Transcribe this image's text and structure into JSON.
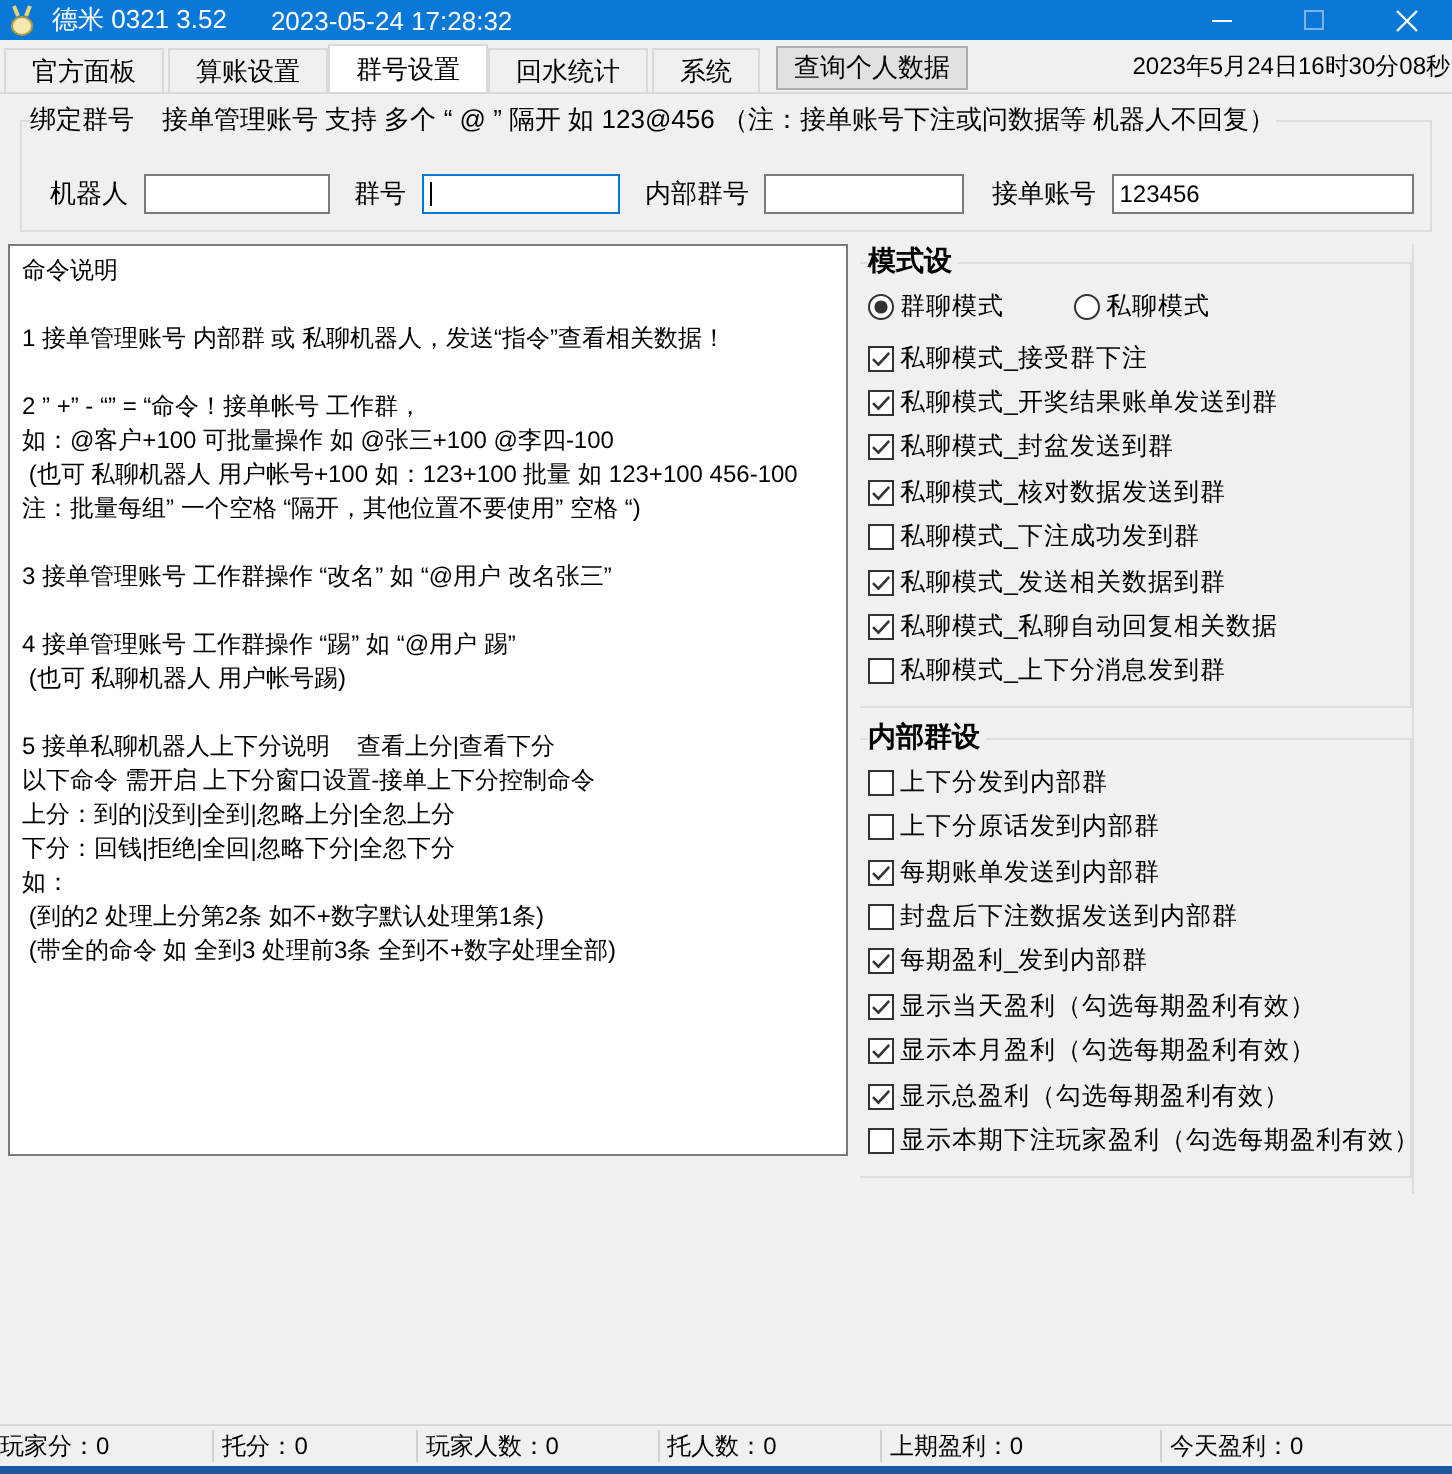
{
  "window": {
    "title": "德米 0321 3.52",
    "time": "2023-05-24 17:28:32"
  },
  "tabs": [
    {
      "label": "官方面板",
      "selected": false
    },
    {
      "label": "算账设置",
      "selected": false
    },
    {
      "label": "群号设置",
      "selected": true
    },
    {
      "label": "回水统计",
      "selected": false
    },
    {
      "label": "系统",
      "selected": false
    }
  ],
  "query_button": "查询个人数据",
  "clock": "2023年5月24日16时30分08秒",
  "bind_group": {
    "title": "绑定群号",
    "note": "接单管理账号 支持 多个 “ @ ” 隔开 如 123@456 （注：接单账号下注或问数据等 机器人不回复）",
    "fields": [
      {
        "label": "机器人",
        "focused": false
      },
      {
        "label": "群号",
        "focused": true
      },
      {
        "label": "内部群号",
        "focused": false
      },
      {
        "label": "接单账号",
        "value": "123456",
        "focused": false
      }
    ]
  },
  "instructions": {
    "paragraphs": [
      [
        "命令说明"
      ],
      [
        "1 接单管理账号 内部群 或 私聊机器人，发送“指令”查看相关数据！"
      ],
      [
        "2 ” +” - “” = “命令！接单帐号 工作群，",
        "如：@客户+100 可批量操作 如 @张三+100 @李四-100",
        " (也可 私聊机器人 用户帐号+100 如：123+100 批量 如 123+100 456-100",
        "注：批量每组” 一个空格 “隔开，其他位置不要使用” 空格 “)"
      ],
      [
        "3 接单管理账号 工作群操作 “改名” 如 “@用户 改名张三”"
      ],
      [
        "4 接单管理账号 工作群操作 “踢” 如 “@用户 踢”",
        " (也可 私聊机器人 用户帐号踢)"
      ],
      [
        "5 接单私聊机器人上下分说明    查看上分|查看下分",
        "以下命令 需开启 上下分窗口设置-接单上下分控制命令",
        "上分：到的|没到|全到|忽略上分|全忽上分",
        "下分：回钱|拒绝|全回|忽略下分|全忽下分",
        "如：",
        " (到的2 处理上分第2条 如不+数字默认处理第1条)",
        " (带全的命令 如 全到3 处理前3条 全到不+数字处理全部)"
      ]
    ]
  },
  "mode_settings": {
    "title": "模式设",
    "modes": [
      {
        "label": "群聊模式",
        "selected": true
      },
      {
        "label": "私聊模式",
        "selected": false
      }
    ],
    "options": [
      {
        "label": "私聊模式_接受群下注",
        "checked": true
      },
      {
        "label": "私聊模式_开奖结果账单发送到群",
        "checked": true
      },
      {
        "label": "私聊模式_封盆发送到群",
        "checked": true
      },
      {
        "label": "私聊模式_核对数据发送到群",
        "checked": true
      },
      {
        "label": "私聊模式_下注成功发到群",
        "checked": false
      },
      {
        "label": "私聊模式_发送相关数据到群",
        "checked": true
      },
      {
        "label": "私聊模式_私聊自动回复相关数据",
        "checked": true
      },
      {
        "label": "私聊模式_上下分消息发到群",
        "checked": false
      }
    ]
  },
  "internal_group_settings": {
    "title": "内部群设",
    "options": [
      {
        "label": "上下分发到内部群",
        "checked": false
      },
      {
        "label": "上下分原话发到内部群",
        "checked": false
      },
      {
        "label": "每期账单发送到内部群",
        "checked": true
      },
      {
        "label": "封盘后下注数据发送到内部群",
        "checked": false
      },
      {
        "label": "每期盈利_发到内部群",
        "checked": true
      },
      {
        "label": "显示当天盈利（勾选每期盈利有效）",
        "checked": true
      },
      {
        "label": "显示本月盈利（勾选每期盈利有效）",
        "checked": true
      },
      {
        "label": "显示总盈利（勾选每期盈利有效）",
        "checked": true
      },
      {
        "label": "显示本期下注玩家盈利（勾选每期盈利有效）",
        "checked": false
      }
    ]
  },
  "status_bar": [
    "玩家分：0",
    "托分：0",
    "玩家人数：0",
    "托人数：0",
    "上期盈利：0",
    "今天盈利：0"
  ]
}
